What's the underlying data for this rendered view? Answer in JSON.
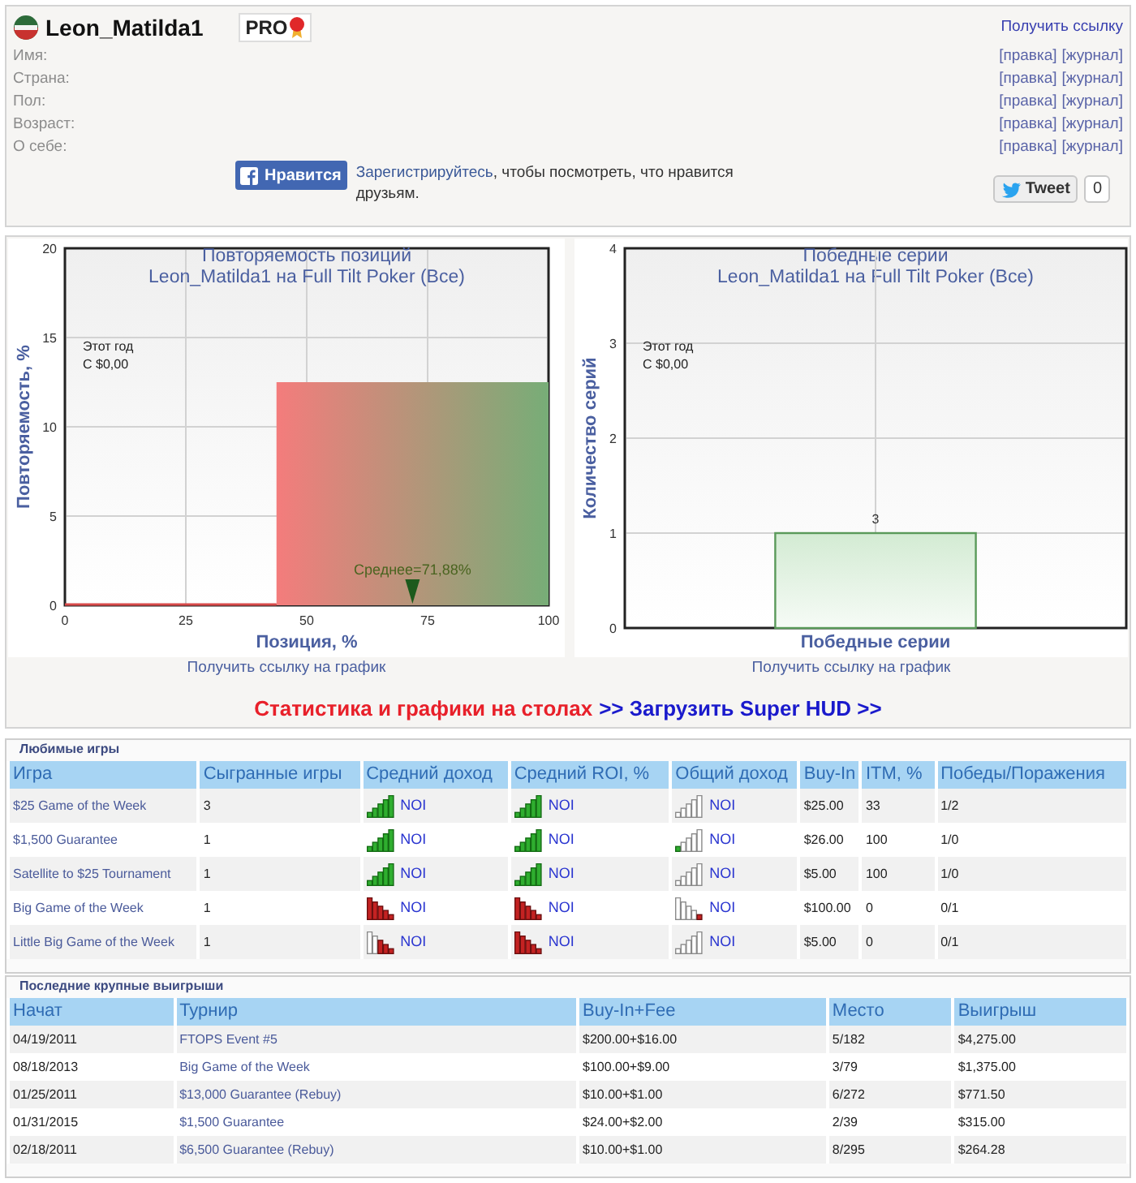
{
  "profile": {
    "username": "Leon_Matilda1",
    "badge": "PRO",
    "link": "Получить ссылку",
    "fields": [
      {
        "label": "Имя:",
        "actions": [
          "[правка]",
          "[журнал]"
        ]
      },
      {
        "label": "Страна:",
        "actions": [
          "[правка]",
          "[журнал]"
        ]
      },
      {
        "label": "Пол:",
        "actions": [
          "[правка]",
          "[журнал]"
        ]
      },
      {
        "label": "Возраст:",
        "actions": [
          "[правка]",
          "[журнал]"
        ]
      },
      {
        "label": "О себе:",
        "actions": [
          "[правка]",
          "[журнал]"
        ]
      }
    ],
    "like_button": "Нравится",
    "like_prompt": {
      "link": "Зарегистрируйтесь",
      "text": ", чтобы посмотреть, что нравится друзьям."
    },
    "tweet_button": "Tweet",
    "tweet_count": "0"
  },
  "charts": [
    {
      "subtitle": "Leon_Matilda1 на Full Tilt Poker (Все)",
      "notes": [
        "Этот год",
        "С $0,00"
      ],
      "link": "Получить ссылку на график",
      "chart_data": {
        "type": "area",
        "title": "Повторяемость позиций",
        "xlabel": "Позиция, %",
        "ylabel": "Повторяемость, %",
        "x": [
          43.75,
          100
        ],
        "values": [
          12.5,
          12.5
        ],
        "xlim": [
          0,
          100
        ],
        "ylim": [
          0,
          20
        ],
        "xticks": [
          0,
          25,
          50,
          75,
          100
        ],
        "yticks": [
          0,
          5,
          10,
          15,
          20
        ],
        "grid": true,
        "annotations": [
          "Среднее=71,88%"
        ]
      }
    },
    {
      "subtitle": "Leon_Matilda1 на Full Tilt Poker (Все)",
      "notes": [
        "Этот год",
        "С $0,00"
      ],
      "link": "Получить ссылку на график",
      "chart_data": {
        "type": "bar",
        "title": "Победные серии",
        "xlabel": "Победные серии",
        "ylabel": "Количество серий",
        "categories": [
          "3"
        ],
        "values": [
          1
        ],
        "ylim": [
          0,
          4
        ],
        "yticks": [
          0,
          1,
          2,
          3,
          4
        ],
        "grid": true
      }
    }
  ],
  "promo": {
    "text": "Статистика и графики на столах",
    "link": ">> Загрузить Super HUD >>"
  },
  "favorite_games": {
    "title": "Любимые игры",
    "columns": [
      "Игра",
      "Сыгранные игры",
      "Средний доход",
      "Средний ROI, %",
      "Общий доход",
      "Buy-In",
      "ITM, %",
      "Победы/Поражения"
    ],
    "rows": [
      {
        "game": "$25 Game of the Week",
        "played": "3",
        "avg_income": {
          "kind": "gainfull",
          "label": "NOI"
        },
        "avg_roi": {
          "kind": "gainfull",
          "label": "NOI"
        },
        "total_income": {
          "kind": "gainnone",
          "label": "NOI"
        },
        "buy_in": "$25.00",
        "itm": "33",
        "wins_losses": "1/2"
      },
      {
        "game": "$1,500 Guarantee",
        "played": "1",
        "avg_income": {
          "kind": "gainfull",
          "label": "NOI"
        },
        "avg_roi": {
          "kind": "gainfull",
          "label": "NOI"
        },
        "total_income": {
          "kind": "gainlow",
          "label": "NOI"
        },
        "buy_in": "$26.00",
        "itm": "100",
        "wins_losses": "1/0"
      },
      {
        "game": "Satellite to $25 Tournament",
        "played": "1",
        "avg_income": {
          "kind": "gainfull",
          "label": "NOI"
        },
        "avg_roi": {
          "kind": "gainfull",
          "label": "NOI"
        },
        "total_income": {
          "kind": "gainnone",
          "label": "NOI"
        },
        "buy_in": "$5.00",
        "itm": "100",
        "wins_losses": "1/0"
      },
      {
        "game": "Big Game of the Week",
        "played": "1",
        "avg_income": {
          "kind": "lossfull",
          "label": "NOI"
        },
        "avg_roi": {
          "kind": "lossfull",
          "label": "NOI"
        },
        "total_income": {
          "kind": "losslow",
          "label": "NOI"
        },
        "buy_in": "$100.00",
        "itm": "0",
        "wins_losses": "0/1"
      },
      {
        "game": "Little Big Game of the Week",
        "played": "1",
        "avg_income": {
          "kind": "losshalf",
          "label": "NOI"
        },
        "avg_roi": {
          "kind": "lossfull",
          "label": "NOI"
        },
        "total_income": {
          "kind": "gainnone",
          "label": "NOI"
        },
        "buy_in": "$5.00",
        "itm": "0",
        "wins_losses": "0/1"
      }
    ]
  },
  "big_wins": {
    "title": "Последние крупные выигрыши",
    "columns": [
      "Начат",
      "Турнир",
      "Buy-In+Fee",
      "Место",
      "Выигрыш"
    ],
    "rows": [
      {
        "started": "04/19/2011",
        "tournament": "FTOPS Event #5",
        "buy_in_fee": "$200.00+$16.00",
        "place": "5/182",
        "winnings": "$4,275.00"
      },
      {
        "started": "08/18/2013",
        "tournament": "Big Game of the Week",
        "buy_in_fee": "$100.00+$9.00",
        "place": "3/79",
        "winnings": "$1,375.00"
      },
      {
        "started": "01/25/2011",
        "tournament": "$13,000 Guarantee (Rebuy)",
        "buy_in_fee": "$10.00+$1.00",
        "place": "6/272",
        "winnings": "$771.50"
      },
      {
        "started": "01/31/2015",
        "tournament": "$1,500 Guarantee",
        "buy_in_fee": "$24.00+$2.00",
        "place": "2/39",
        "winnings": "$315.00"
      },
      {
        "started": "02/18/2011",
        "tournament": "$6,500 Guarantee (Rebuy)",
        "buy_in_fee": "$10.00+$1.00",
        "place": "8/295",
        "winnings": "$264.28"
      }
    ]
  }
}
